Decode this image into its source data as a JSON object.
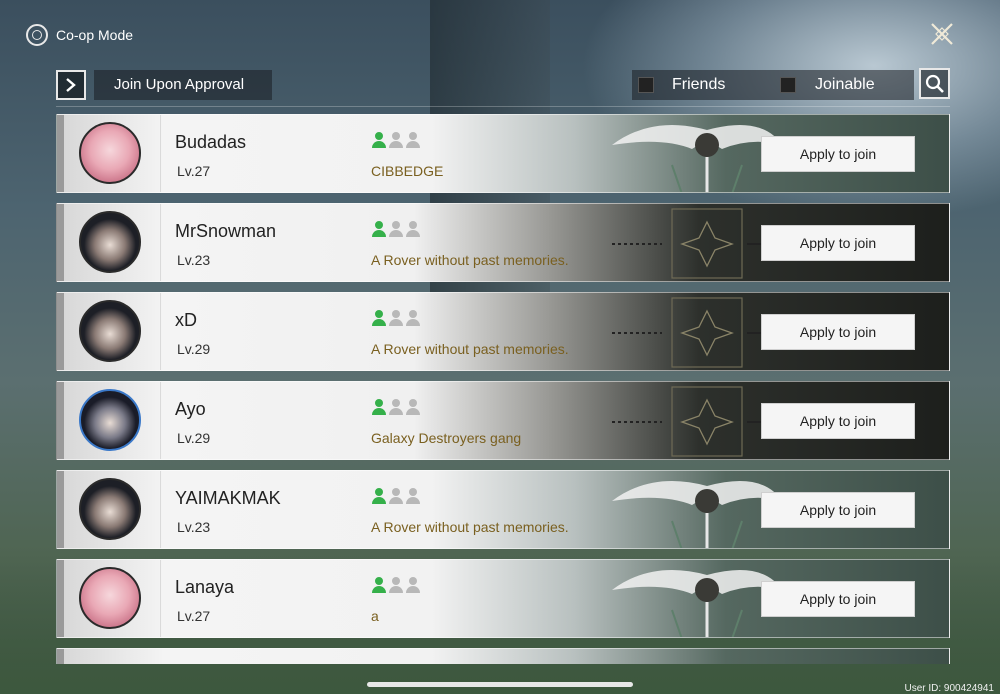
{
  "header": {
    "title": "Co-op Mode",
    "close_icon": "close-x-icon"
  },
  "filters": {
    "approval_label": "Join Upon Approval",
    "friends_label": "Friends",
    "joinable_label": "Joinable",
    "friends_checked": false,
    "joinable_checked": false
  },
  "colors": {
    "party_active": "#35b04a",
    "party_empty": "#b8b8b8",
    "signature_text": "#7a6020"
  },
  "players": [
    {
      "name": "Budadas",
      "level": "Lv.27",
      "signature": "CIBBEDGE",
      "avatar": "pink",
      "bg": "light",
      "party_filled": 1,
      "party_size": 3,
      "button_label": "Apply to join"
    },
    {
      "name": "MrSnowman",
      "level": "Lv.23",
      "signature": "A Rover without past memories.",
      "avatar": "dark",
      "bg": "dark",
      "party_filled": 1,
      "party_size": 3,
      "button_label": "Apply to join"
    },
    {
      "name": "xD",
      "level": "Lv.29",
      "signature": "A Rover without past memories.",
      "avatar": "dark",
      "bg": "dark",
      "party_filled": 1,
      "party_size": 3,
      "button_label": "Apply to join"
    },
    {
      "name": "Ayo",
      "level": "Lv.29",
      "signature": "Galaxy Destroyers gang",
      "avatar": "blue",
      "bg": "dark",
      "party_filled": 1,
      "party_size": 3,
      "button_label": "Apply to join"
    },
    {
      "name": "YAIMAKMAK",
      "level": "Lv.23",
      "signature": "A Rover without past memories.",
      "avatar": "dark",
      "bg": "light",
      "party_filled": 1,
      "party_size": 3,
      "button_label": "Apply to join"
    },
    {
      "name": "Lanaya",
      "level": "Lv.27",
      "signature": "a",
      "avatar": "pink",
      "bg": "light",
      "party_filled": 1,
      "party_size": 3,
      "button_label": "Apply to join"
    }
  ],
  "footer": {
    "user_id": "User ID: 900424941"
  }
}
